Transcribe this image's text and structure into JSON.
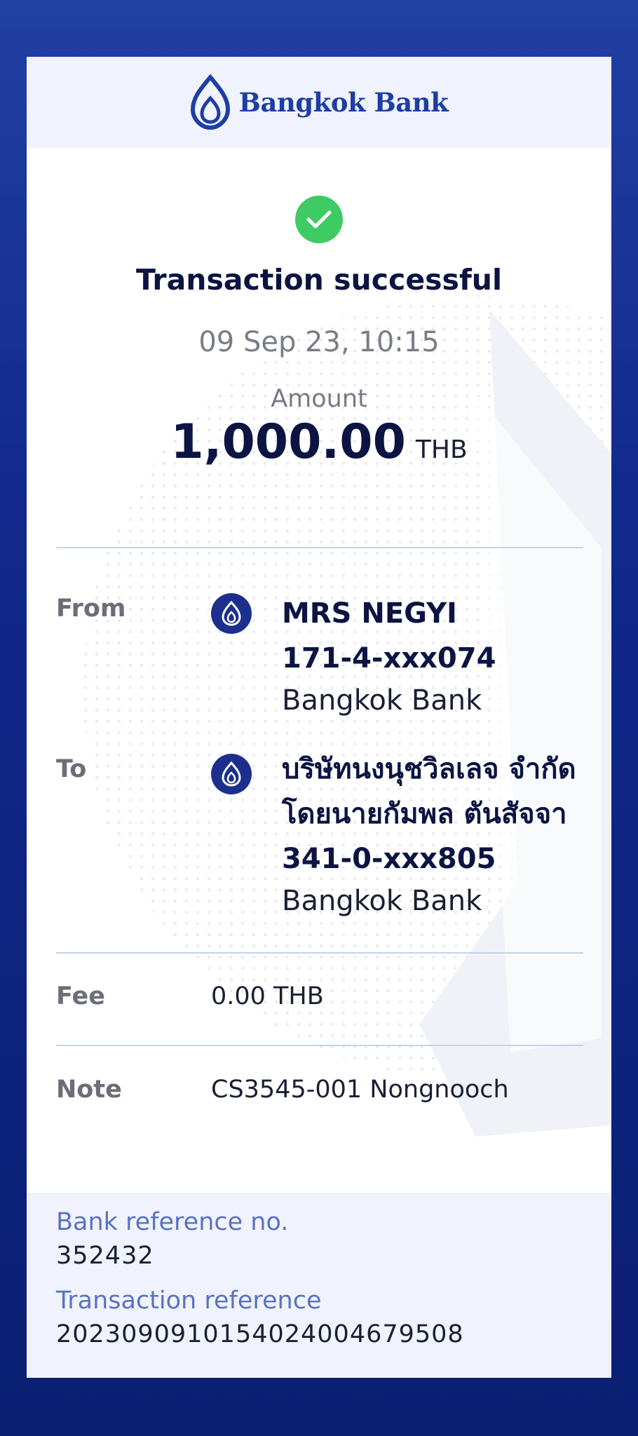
{
  "brand": {
    "name": "Bangkok Bank"
  },
  "status": {
    "title": "Transaction successful",
    "datetime": "09 Sep 23, 10:15"
  },
  "amount": {
    "label": "Amount",
    "value": "1,000.00",
    "currency": "THB"
  },
  "from": {
    "label": "From",
    "name": "MRS NEGYI",
    "account": "171-4-xxx074",
    "bank": "Bangkok Bank"
  },
  "to": {
    "label": "To",
    "name_line1": "บริษัทนงนุชวิลเลจ จำกัด",
    "name_line2": "โดยนายกัมพล ตันสัจจา",
    "account": "341-0-xxx805",
    "bank": "Bangkok Bank"
  },
  "fee": {
    "label": "Fee",
    "value": "0.00 THB"
  },
  "note": {
    "label": "Note",
    "value": "CS3545-001 Nongnooch"
  },
  "references": {
    "bank_ref_label": "Bank reference no.",
    "bank_ref_value": "352432",
    "txn_ref_label": "Transaction reference",
    "txn_ref_value": "2023090910154024004679508"
  },
  "colors": {
    "brand_blue": "#1d3ea6",
    "success_green": "#3ecb63",
    "ref_label": "#5a72c2"
  }
}
